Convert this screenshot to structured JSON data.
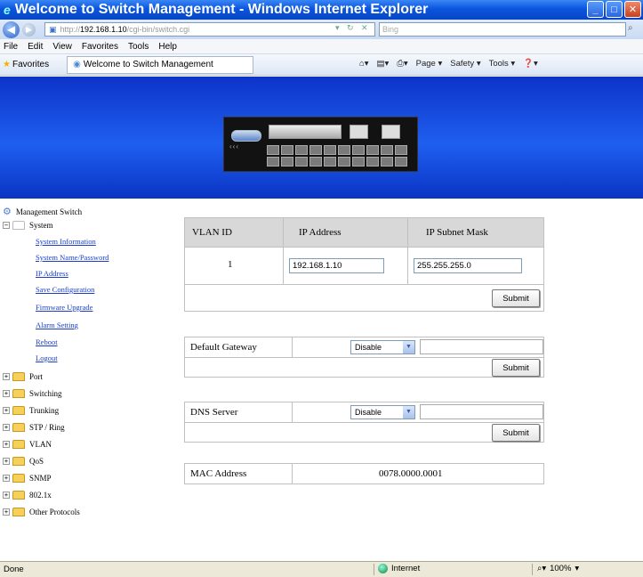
{
  "window": {
    "title": "Welcome to Switch Management - Windows Internet Explorer",
    "controls": [
      "_",
      "□",
      "✕"
    ]
  },
  "address_bar": {
    "url_prefix": "http://",
    "url_host": "192.168.1.10",
    "url_path": "/cgi-bin/switch.cgi",
    "search_placeholder": "Bing"
  },
  "menu": [
    "File",
    "Edit",
    "View",
    "Favorites",
    "Tools",
    "Help"
  ],
  "favorites_bar": {
    "label": "Favorites",
    "tab_title": "Welcome to Switch Management",
    "commands": [
      "Page ▾",
      "Safety ▾",
      "Tools ▾",
      "❓▾"
    ]
  },
  "tree": {
    "root": "Management Switch",
    "system_label": "System",
    "system_items": [
      "System Information",
      "System Name/Password",
      "IP Address",
      "Save Configuration",
      "Firmware Upgrade",
      "Alarm Setting",
      "Reboot",
      "Logout"
    ],
    "folders": [
      "Port",
      "Switching",
      "Trunking",
      "STP / Ring",
      "VLAN",
      "QoS",
      "SNMP",
      "802.1x",
      "Other Protocols"
    ]
  },
  "ip_table": {
    "headers": [
      "VLAN ID",
      "IP Address",
      "IP Subnet Mask"
    ],
    "vlan_id": "1",
    "ip_address": "192.168.1.10",
    "subnet_mask": "255.255.255.0",
    "submit_label": "Submit"
  },
  "gateway": {
    "label": "Default Gateway",
    "mode": "Disable",
    "value": "",
    "submit_label": "Submit"
  },
  "dns": {
    "label": "DNS Server",
    "mode": "Disable",
    "value": "",
    "submit_label": "Submit"
  },
  "mac": {
    "label": "MAC Address",
    "value": "0078.0000.0001"
  },
  "status_bar": {
    "left": "Done",
    "zone": "Internet",
    "zoom": "100%"
  }
}
